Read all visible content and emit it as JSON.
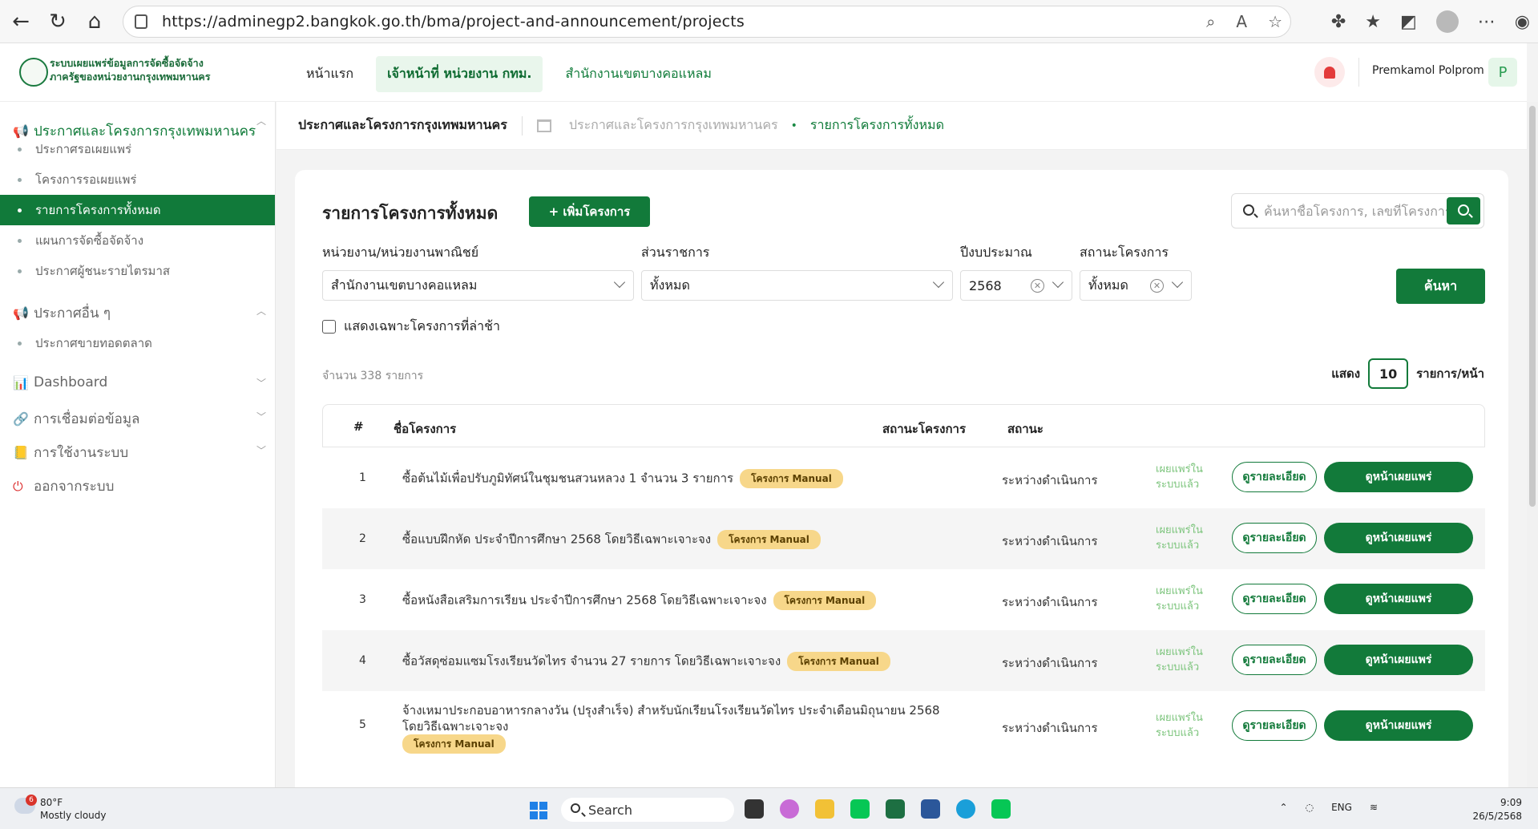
{
  "browser": {
    "url": "https://adminegp2.bangkok.go.th/bma/project-and-announcement/projects"
  },
  "header": {
    "logo_line1": "ระบบเผยแพร่ข้อมูลการจัดซื้อจัดจ้าง",
    "logo_line2": "ภาครัฐของหน่วยงานกรุงเทพมหานคร",
    "nav_home": "หน้าแรก",
    "nav_role": "เจ้าหน้าที่ หน่วยงาน กทม.",
    "nav_office": "สำนักงานเขตบางคอแหลม",
    "user_name": "Premkamol Polprom",
    "avatar_letter": "P"
  },
  "sidebar": {
    "group1": "ประกาศและโครงการกรุงเทพมหานคร",
    "group1_items": [
      "ประกาศรอเผยแพร่",
      "โครงการรอเผยแพร่",
      "รายการโครงการทั้งหมด",
      "แผนการจัดซื้อจัดจ้าง",
      "ประกาศผู้ชนะรายไตรมาส"
    ],
    "group2": "ประกาศอื่น ๆ",
    "group2_items": [
      "ประกาศขายทอดตลาด"
    ],
    "dashboard": "Dashboard",
    "connect": "การเชื่อมต่อข้อมูล",
    "usage": "การใช้งานระบบ",
    "logout": "ออกจากระบบ"
  },
  "breadcrumb": {
    "title": "ประกาศและโครงการกรุงเทพมหานคร",
    "crumb1": "ประกาศและโครงการกรุงเทพมหานคร",
    "crumb2": "รายการโครงการทั้งหมด"
  },
  "main": {
    "title": "รายการโครงการทั้งหมด",
    "add_button": "+ เพิ่มโครงการ",
    "search_placeholder": "ค้นหาชื่อโครงการ, เลขที่โครงการ",
    "filter_agency_label": "หน่วยงาน/หน่วยงานพาณิชย์",
    "filter_agency_value": "สำนักงานเขตบางคอแหลม",
    "filter_division_label": "ส่วนราชการ",
    "filter_division_value": "ทั้งหมด",
    "filter_year_label": "ปีงบประมาณ",
    "filter_year_value": "2568",
    "filter_status_label": "สถานะโครงการ",
    "filter_status_value": "ทั้งหมด",
    "find_button": "ค้นหา",
    "late_only_label": "แสดงเฉพาะโครงการที่ล่าช้า",
    "count_text": "จำนวน  338  รายการ",
    "show_label": "แสดง",
    "per_page": "10",
    "per_page_unit": "รายการ/หน้า",
    "columns": [
      "#",
      "ชื่อโครงการ",
      "สถานะโครงการ",
      "สถานะ"
    ],
    "rows": [
      {
        "num": "1",
        "name": "ซื้อต้นไม้เพื่อปรับภูมิทัศน์ในชุมชนสวนหลวง 1 จำนวน 3 รายการ",
        "tag": "โครงการ Manual",
        "status": "ระหว่างดำเนินการ",
        "publish1": "เผยแพร่ใน",
        "publish2": "ระบบแล้ว",
        "detail": "ดูรายละเอียด",
        "view": "ดูหน้าเผยแพร่"
      },
      {
        "num": "2",
        "name": "ซื้อแบบฝึกหัด ประจำปีการศึกษา 2568 โดยวิธีเฉพาะเจาะจง",
        "tag": "โครงการ Manual",
        "status": "ระหว่างดำเนินการ",
        "publish1": "เผยแพร่ใน",
        "publish2": "ระบบแล้ว",
        "detail": "ดูรายละเอียด",
        "view": "ดูหน้าเผยแพร่"
      },
      {
        "num": "3",
        "name": "ซื้อหนังสือเสริมการเรียน ประจำปีการศึกษา 2568 โดยวิธีเฉพาะเจาะจง",
        "tag": "โครงการ Manual",
        "status": "ระหว่างดำเนินการ",
        "publish1": "เผยแพร่ใน",
        "publish2": "ระบบแล้ว",
        "detail": "ดูรายละเอียด",
        "view": "ดูหน้าเผยแพร่"
      },
      {
        "num": "4",
        "name": "ซื้อวัสดุซ่อมแซมโรงเรียนวัดไทร จำนวน 27 รายการ โดยวิธีเฉพาะเจาะจง",
        "tag": "โครงการ Manual",
        "status": "ระหว่างดำเนินการ",
        "publish1": "เผยแพร่ใน",
        "publish2": "ระบบแล้ว",
        "detail": "ดูรายละเอียด",
        "view": "ดูหน้าเผยแพร่"
      },
      {
        "num": "5",
        "name": "จ้างเหมาประกอบอาหารกลางวัน (ปรุงสำเร็จ) สำหรับนักเรียนโรงเรียนวัดไทร ประจำเดือนมิถุนายน 2568 โดยวิธีเฉพาะเจาะจง",
        "tag": "โครงการ Manual",
        "status": "ระหว่างดำเนินการ",
        "publish1": "เผยแพร่ใน",
        "publish2": "ระบบแล้ว",
        "detail": "ดูรายละเอียด",
        "view": "ดูหน้าเผยแพร่"
      }
    ]
  },
  "taskbar": {
    "weather_badge": "6",
    "temperature": "80°F",
    "weather": "Mostly cloudy",
    "search": "Search",
    "lang": "ENG",
    "time": "9:09",
    "date": "26/5/2568"
  }
}
